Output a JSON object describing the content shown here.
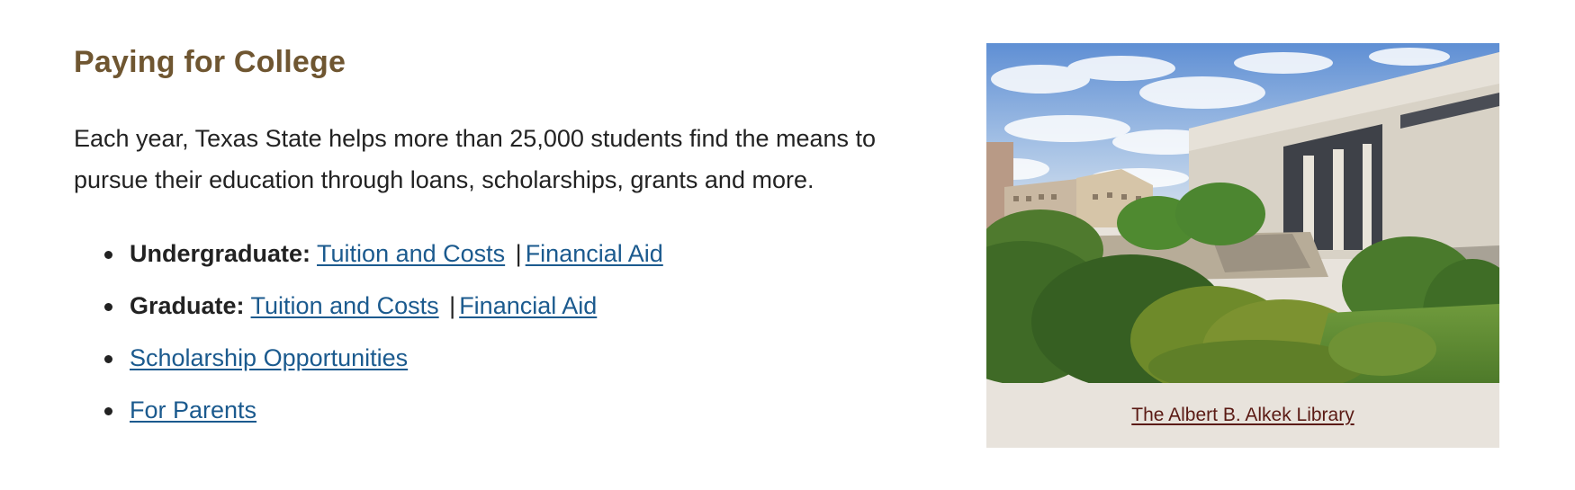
{
  "section": {
    "title": "Paying for College",
    "intro": "Each year, Texas State helps more than 25,000 students find the means to pursue their education through loans, scholarships, grants and more."
  },
  "links": {
    "undergraduate": {
      "label": "Undergraduate:",
      "tuition": "Tuition and Costs",
      "separator": "|",
      "aid": "Financial Aid"
    },
    "graduate": {
      "label": "Graduate:",
      "tuition": "Tuition and Costs",
      "separator": "|",
      "aid": "Financial Aid"
    },
    "scholarships": "Scholarship Opportunities",
    "parents": "For Parents"
  },
  "figure": {
    "image_alt": "The Albert B. Alkek Library",
    "caption": "The Albert B. Alkek Library"
  },
  "colors": {
    "heading": "#6f5631",
    "link": "#1b5a8e",
    "caption_link": "#5a1a14",
    "caption_background": "#e8e3dc"
  }
}
